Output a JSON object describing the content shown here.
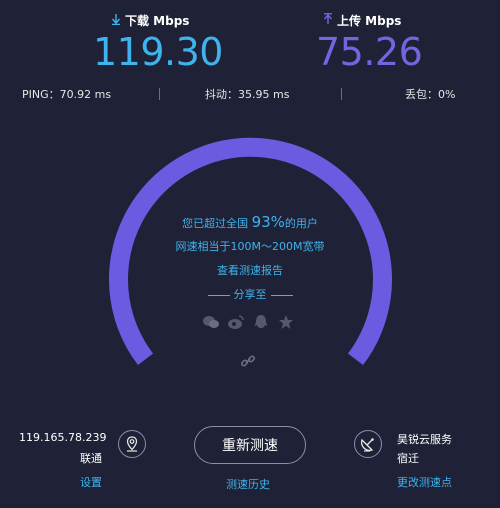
{
  "download": {
    "label": "下载 Mbps",
    "value": "119.30",
    "color": "#3fb3ee"
  },
  "upload": {
    "label": "上传 Mbps",
    "value": "75.26",
    "color": "#7564e0"
  },
  "stats": {
    "ping": "PING：70.92 ms",
    "jitter": "抖动：35.95 ms",
    "loss": "丢包：0%"
  },
  "result": {
    "beat_prefix": "您已超过全国",
    "beat_percent": "93%",
    "beat_suffix": "的用户",
    "equivalent": "网速相当于100M～200M宽带",
    "report_link": "查看测速报告",
    "share_label": "分享至"
  },
  "share_icons": [
    "wechat-icon",
    "weibo-icon",
    "qq-icon",
    "favorite-icon"
  ],
  "client": {
    "ip": "119.165.78.239",
    "isp": "联通",
    "settings_link": "设置"
  },
  "retest_button": "重新测速",
  "history_link": "测速历史",
  "server": {
    "name": "昊锐云服务",
    "city": "宿迁",
    "change_link": "更改测速点"
  },
  "colors": {
    "background": "#1f2236",
    "gauge": "#6a5be0",
    "accent": "#3fb3ee"
  }
}
